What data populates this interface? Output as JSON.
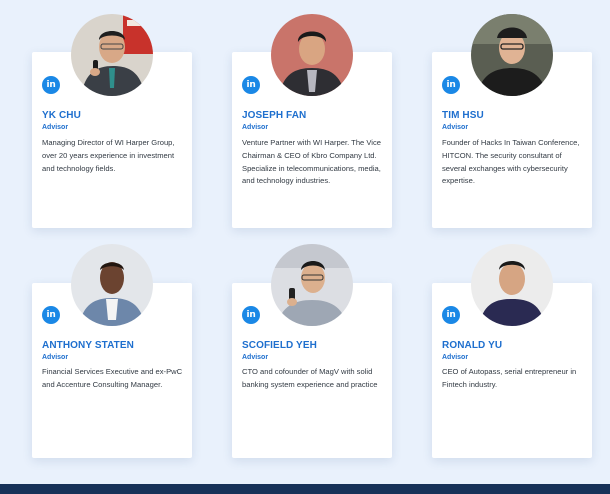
{
  "team": {
    "members": [
      {
        "name": "YK CHU",
        "role": "Advisor",
        "linkedin_label": "in",
        "description": "Managing Director of WI Harper Group, over 20 years experience in investment and technology fields."
      },
      {
        "name": "JOSEPH FAN",
        "role": "Advisor",
        "linkedin_label": "in",
        "description": "Venture Partner with WI Harper. The Vice Chairman & CEO of Kbro Company Ltd. Specialize in telecommunications, media, and technology industries."
      },
      {
        "name": "TIM HSU",
        "role": "Advisor",
        "linkedin_label": "in",
        "description": "Founder of Hacks In Taiwan Conference, HITCON. The security consultant of several exchanges with cybersecurity expertise."
      },
      {
        "name": "ANTHONY STATEN",
        "role": "Advisor",
        "linkedin_label": "in",
        "description": "Financial Services Executive and ex-PwC and Accenture Consulting Manager."
      },
      {
        "name": "SCOFIELD YEH",
        "role": "Advisor",
        "linkedin_label": "in",
        "description": "CTO and cofounder of MagV with solid banking system experience and practice"
      },
      {
        "name": "RONALD YU",
        "role": "Advisor",
        "linkedin_label": "in",
        "description": "CEO of Autopass, serial entrepreneur in Fintech industry."
      }
    ]
  },
  "colors": {
    "background": "#e9f1fc",
    "accent": "#1e6fce",
    "linkedin": "#1a88e6",
    "footer": "#173158"
  },
  "icons": {
    "linkedin": "linkedin-icon"
  }
}
